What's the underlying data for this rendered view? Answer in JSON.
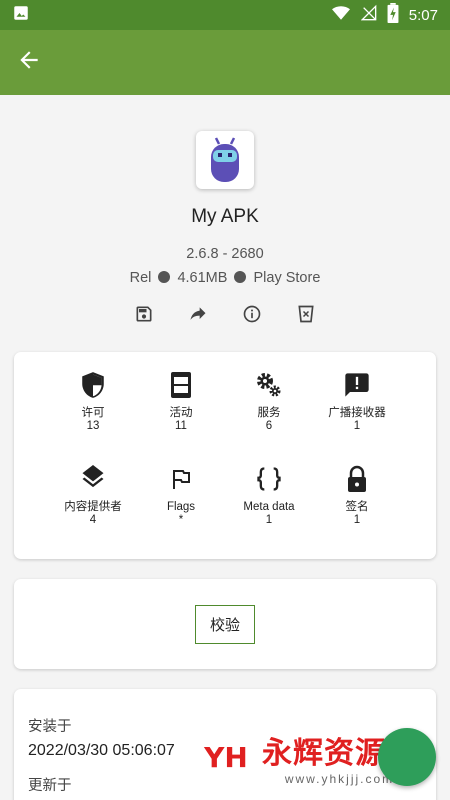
{
  "status_bar": {
    "time": "5:07",
    "icons": [
      "image-icon",
      "wifi-icon",
      "signal-off-icon",
      "battery-charging-icon"
    ]
  },
  "app_bar": {
    "back_icon": "arrow-left-icon"
  },
  "app": {
    "name": "My APK",
    "version": "2.6.8 - 2680",
    "channel": "Rel",
    "size": "4.61MB",
    "source": "Play Store"
  },
  "actions": [
    {
      "name": "save-icon"
    },
    {
      "name": "share-icon"
    },
    {
      "name": "info-icon"
    },
    {
      "name": "clear-data-icon"
    }
  ],
  "components": [
    {
      "icon": "shield-icon",
      "label": "许可",
      "count": "13"
    },
    {
      "icon": "activity-icon",
      "label": "活动",
      "count": "11"
    },
    {
      "icon": "gears-icon",
      "label": "服务",
      "count": "6"
    },
    {
      "icon": "alert-message-icon",
      "label": "广播接收器",
      "count": "1"
    },
    {
      "icon": "layers-icon",
      "label": "内容提供者",
      "count": "4"
    },
    {
      "icon": "flag-icon",
      "label": "Flags",
      "count": "*"
    },
    {
      "icon": "braces-icon",
      "label": "Meta data",
      "count": "1"
    },
    {
      "icon": "lock-icon",
      "label": "签名",
      "count": "1"
    }
  ],
  "verify": {
    "label": "校验"
  },
  "install": {
    "installed_label": "安装于",
    "installed_value": "2022/03/30 05:06:07",
    "updated_label": "更新于"
  },
  "watermark": {
    "logo": "YH",
    "title": "永辉资源网",
    "url": "www.yhkjjj.com"
  },
  "colors": {
    "status_bar": "#4f8a2d",
    "app_bar": "#6a9c3a",
    "accent": "#4f8a2d",
    "fab": "#2e9e5a",
    "watermark": "#e02020"
  }
}
